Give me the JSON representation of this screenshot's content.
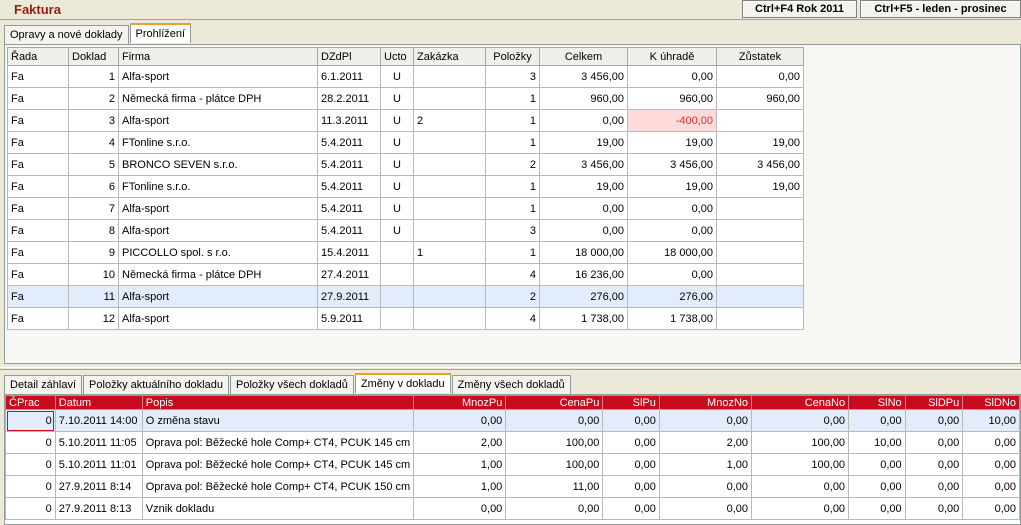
{
  "app": {
    "title": "Faktura"
  },
  "header": {
    "year_button": "Ctrl+F4 Rok 2011",
    "period_button": "Ctrl+F5 - leden - prosinec"
  },
  "top_tabs": [
    {
      "label": "Opravy a nové doklady"
    },
    {
      "label": "Prohlížení"
    }
  ],
  "invoices": {
    "columns": [
      "Řada",
      "Doklad",
      "Firma",
      "DZdPl",
      "Ucto",
      "Zakázka",
      "Položky",
      "Celkem",
      "K úhradě",
      "Zůstatek"
    ],
    "rows": [
      [
        "Fa",
        "1",
        "Alfa-sport",
        "6.1.2011",
        "U",
        "",
        "3",
        "3 456,00",
        "0,00",
        "0,00"
      ],
      [
        "Fa",
        "2",
        "Německá firma - plátce DPH",
        "28.2.2011",
        "U",
        "",
        "1",
        "960,00",
        "960,00",
        "960,00"
      ],
      [
        "Fa",
        "3",
        "Alfa-sport",
        "11.3.2011",
        "U",
        "2",
        "1",
        "0,00",
        "-400,00",
        ""
      ],
      [
        "Fa",
        "4",
        "FTonline s.r.o.",
        "5.4.2011",
        "U",
        "",
        "1",
        "19,00",
        "19,00",
        "19,00"
      ],
      [
        "Fa",
        "5",
        "BRONCO SEVEN s.r.o.",
        "5.4.2011",
        "U",
        "",
        "2",
        "3 456,00",
        "3 456,00",
        "3 456,00"
      ],
      [
        "Fa",
        "6",
        "FTonline s.r.o.",
        "5.4.2011",
        "U",
        "",
        "1",
        "19,00",
        "19,00",
        "19,00"
      ],
      [
        "Fa",
        "7",
        "Alfa-sport",
        "5.4.2011",
        "U",
        "",
        "1",
        "0,00",
        "0,00",
        ""
      ],
      [
        "Fa",
        "8",
        "Alfa-sport",
        "5.4.2011",
        "U",
        "",
        "3",
        "0,00",
        "0,00",
        ""
      ],
      [
        "Fa",
        "9",
        "PICCOLLO spol. s r.o.",
        "15.4.2011",
        "",
        "1",
        "1",
        "18 000,00",
        "18 000,00",
        ""
      ],
      [
        "Fa",
        "10",
        "Německá firma - plátce DPH",
        "27.4.2011",
        "",
        "",
        "4",
        "16 236,00",
        "0,00",
        ""
      ],
      [
        "Fa",
        "11",
        "Alfa-sport",
        "27.9.2011",
        "",
        "",
        "2",
        "276,00",
        "276,00",
        ""
      ],
      [
        "Fa",
        "12",
        "Alfa-sport",
        "5.9.2011",
        "",
        "",
        "4",
        "1 738,00",
        "1 738,00",
        ""
      ]
    ]
  },
  "bottom_tabs": [
    {
      "label": "Detail záhlaví"
    },
    {
      "label": "Položky aktuálního dokladu"
    },
    {
      "label": "Položky všech dokladů"
    },
    {
      "label": "Změny v dokladu"
    },
    {
      "label": "Změny všech dokladů"
    }
  ],
  "changes": {
    "columns": [
      "ČPrac",
      "Datum",
      "Popis",
      "MnozPu",
      "CenaPu",
      "SlPu",
      "MnozNo",
      "CenaNo",
      "SlNo",
      "SlDPu",
      "SlDNo"
    ],
    "rows": [
      [
        "0",
        "7.10.2011 14:00",
        "O změna stavu",
        "0,00",
        "0,00",
        "0,00",
        "0,00",
        "0,00",
        "0,00",
        "0,00",
        "10,00"
      ],
      [
        "0",
        "5.10.2011 11:05",
        "Oprava pol: Běžecké hole Comp+ CT4, PCUK 145 cm",
        "2,00",
        "100,00",
        "0,00",
        "2,00",
        "100,00",
        "10,00",
        "0,00",
        "0,00"
      ],
      [
        "0",
        "5.10.2011 11:01",
        "Oprava pol: Běžecké hole Comp+ CT4, PCUK 145 cm",
        "1,00",
        "100,00",
        "0,00",
        "1,00",
        "100,00",
        "0,00",
        "0,00",
        "0,00"
      ],
      [
        "0",
        "27.9.2011 8:14",
        "Oprava pol: Běžecké hole Comp+ CT4, PCUK 150 cm",
        "1,00",
        "11,00",
        "0,00",
        "0,00",
        "0,00",
        "0,00",
        "0,00",
        "0,00"
      ],
      [
        "0",
        "27.9.2011 8:13",
        "Vznik dokladu",
        "0,00",
        "0,00",
        "0,00",
        "0,00",
        "0,00",
        "0,00",
        "0,00",
        "0,00"
      ]
    ]
  },
  "colors": {
    "title": "#9b1a10",
    "grid_header_red": "#c80c1e",
    "selection": "#e2ecfa",
    "negative": "#e03030"
  }
}
